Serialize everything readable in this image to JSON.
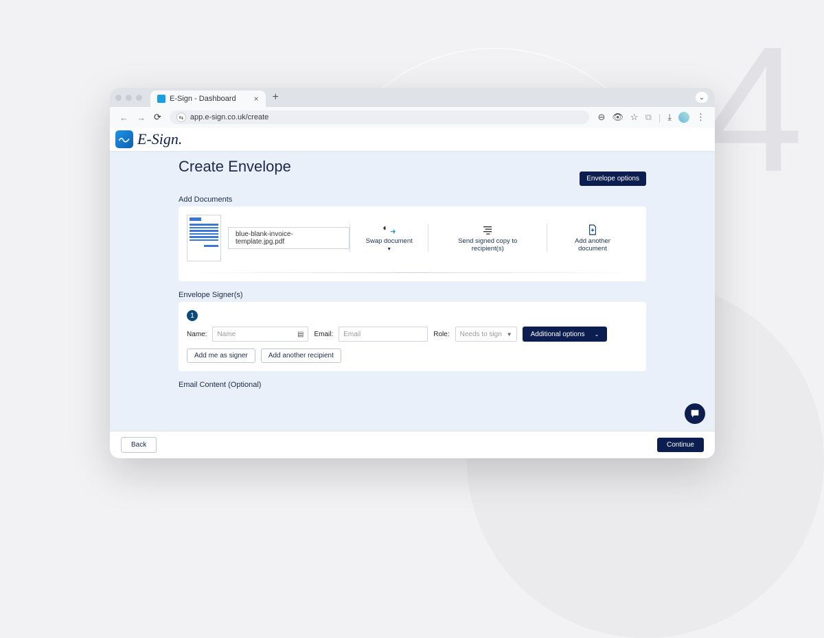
{
  "bg": {
    "number": "4"
  },
  "browser": {
    "tab_title": "E-Sign - Dashboard",
    "url": "app.e-sign.co.uk/create"
  },
  "logo": {
    "text": "E-Sign."
  },
  "page": {
    "title": "Create Envelope",
    "envelope_options": "Envelope options"
  },
  "docs": {
    "section": "Add Documents",
    "filename": "blue-blank-invoice-template.jpg.pdf",
    "swap": "Swap document",
    "send_signed": "Send signed copy to recipient(s)",
    "add_another": "Add another document"
  },
  "signers": {
    "section": "Envelope Signer(s)",
    "badge": "1",
    "name_label": "Name:",
    "name_placeholder": "Name",
    "email_label": "Email:",
    "email_placeholder": "Email",
    "role_label": "Role:",
    "role_value": "Needs to sign",
    "additional": "Additional options",
    "add_me": "Add me as signer",
    "add_recipient": "Add another recipient"
  },
  "email_section": "Email Content (Optional)",
  "footer": {
    "back": "Back",
    "continue": "Continue"
  }
}
